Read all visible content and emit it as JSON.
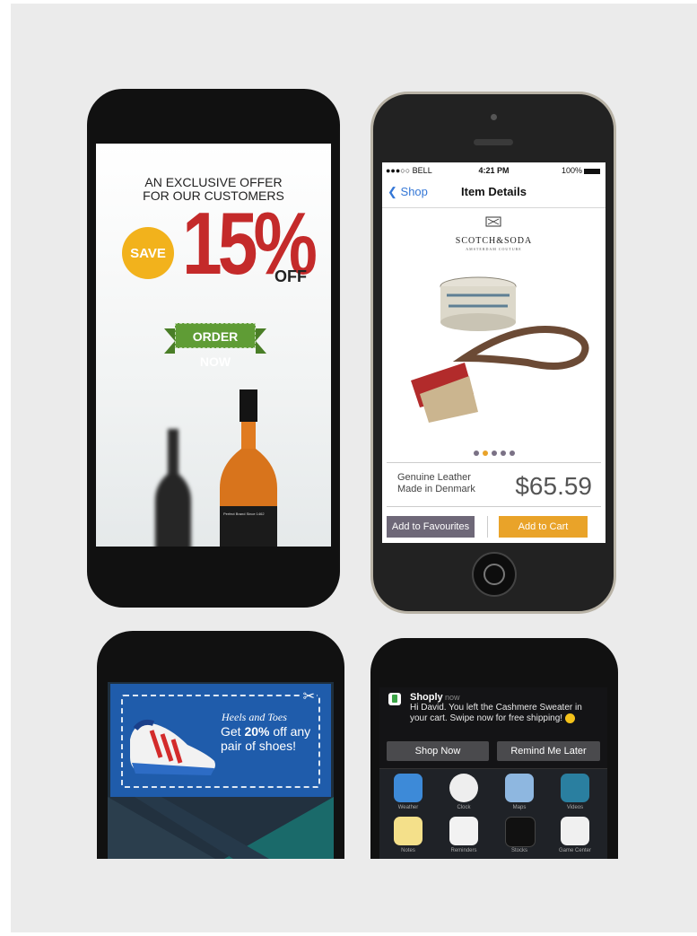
{
  "offer": {
    "title_line1": "AN EXCLUSIVE OFFER",
    "title_line2": "FOR OUR CUSTOMERS",
    "save_badge": "SAVE",
    "percent": "15%",
    "off": "OFF",
    "order_button": "ORDER NOW",
    "bottle_label": "Perfect Brand Since 1462"
  },
  "item_details": {
    "status": {
      "carrier": "●●●○○ BELL",
      "time": "4:21 PM",
      "battery": "100%"
    },
    "nav": {
      "back_label": "Shop",
      "title": "Item Details"
    },
    "brand": "SCOTCH&SODA",
    "brand_sub": "AMSTERDAM COUTURE",
    "carousel": {
      "count": 5,
      "active_index": 1
    },
    "description_line1": "Genuine Leather",
    "description_line2": "Made in Denmark",
    "price": "$65.59",
    "fav_button": "Add to Favourites",
    "cart_button": "Add to Cart",
    "colors": {
      "accent": "#e9a329",
      "secondary": "#6e6878",
      "link": "#3477d6"
    }
  },
  "coupon": {
    "store": "Heels and Toes",
    "text_prefix": "Get ",
    "text_bold": "20%",
    "text_suffix": " off any pair of shoes!",
    "scissors": "✂"
  },
  "notification": {
    "app": "Shoply",
    "time": "now",
    "message": "Hi David. You left the Cashmere Sweater in your cart. Swipe now for free shipping!",
    "button_primary": "Shop Now",
    "button_secondary": "Remind Me Later",
    "apps": [
      "Weather",
      "Clock",
      "Maps",
      "Videos",
      "Notes",
      "Reminders",
      "Stocks",
      "Game Center"
    ]
  }
}
